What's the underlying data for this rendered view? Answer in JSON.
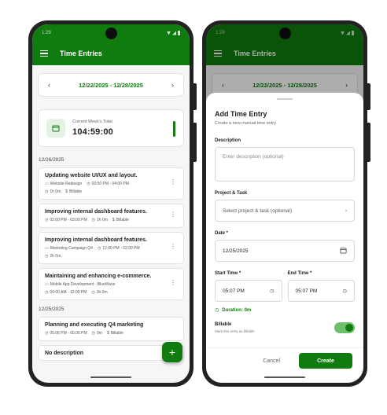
{
  "status": {
    "time": "1:29"
  },
  "app": {
    "title": "Time Entries",
    "accent": "#107C10"
  },
  "week": {
    "range": "12/22/2025 - 12/28/2025",
    "prev_icon": "chevron-left-icon",
    "next_icon": "chevron-right-icon"
  },
  "total": {
    "label": "Current Week's Total",
    "value": "104:59:00"
  },
  "groups": [
    {
      "date": "12/26/2025",
      "entries": [
        {
          "title": "Updating website UI/UX and layout.",
          "project": "Website Redesign",
          "time": "03:00 PM - 04:00 PM",
          "duration": "1h 0m",
          "billable": "Billable"
        },
        {
          "title": "Improving internal dashboard features.",
          "time": "02:00 PM - 03:00 PM",
          "duration": "1h 0m",
          "billable": "Billable"
        },
        {
          "title": "Improving internal dashboard features.",
          "project": "Marketing Campaign Q4",
          "time": "12:00 PM - 02:00 PM",
          "duration": "2h 0m"
        },
        {
          "title": "Maintaining and enhancing e-commerce.",
          "project": "Mobile App Development - BlueWave",
          "time": "09:00 AM - 12:00 PM",
          "duration": "3h 0m"
        }
      ]
    },
    {
      "date": "12/25/2025",
      "entries": [
        {
          "title": "Planning and executing Q4 marketing",
          "time": "05:06 PM - 05:06 PM",
          "duration": "0m",
          "billable": "Billable"
        },
        {
          "title": "No description"
        }
      ]
    }
  ],
  "sheet": {
    "title": "Add Time Entry",
    "subtitle": "Create a new manual time entry",
    "description_label": "Description",
    "description_placeholder": "Enter description (optional)",
    "project_label": "Project & Task",
    "project_placeholder": "Select project & task (optional)",
    "date_label": "Date *",
    "date_value": "12/25/2025",
    "start_label": "Start Time *",
    "start_value": "05:07 PM",
    "end_label": "End Time *",
    "end_value": "05:07 PM",
    "duration": "Duration: 0m",
    "billable_label": "Billable",
    "billable_help": "Mark this entry as billable",
    "billable_on": true,
    "cancel": "Cancel",
    "create": "Create"
  }
}
